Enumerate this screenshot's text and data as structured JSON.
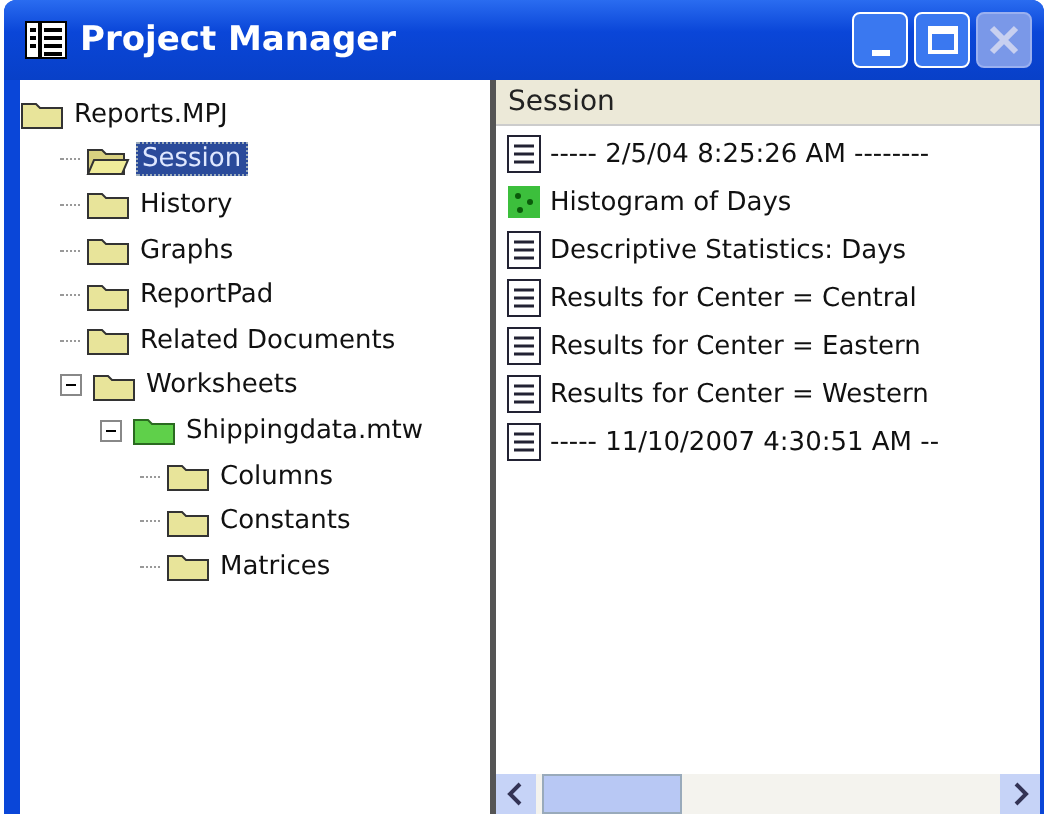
{
  "window": {
    "title": "Project Manager"
  },
  "tree": [
    {
      "label": "Reports.MPJ",
      "kind": "folder",
      "selected": false,
      "children": [
        {
          "label": "Session",
          "kind": "open-folder",
          "selected": true
        },
        {
          "label": "History",
          "kind": "folder",
          "selected": false
        },
        {
          "label": "Graphs",
          "kind": "folder",
          "selected": false
        },
        {
          "label": "ReportPad",
          "kind": "folder",
          "selected": false
        },
        {
          "label": "Related Documents",
          "kind": "folder",
          "selected": false
        },
        {
          "label": "Worksheets",
          "kind": "folder",
          "selected": false,
          "expanded": true,
          "children": [
            {
              "label": "Shippingdata.mtw",
              "kind": "worksheet",
              "selected": false,
              "expanded": true,
              "children": [
                {
                  "label": "Columns",
                  "kind": "folder",
                  "selected": false
                },
                {
                  "label": "Constants",
                  "kind": "folder",
                  "selected": false
                },
                {
                  "label": "Matrices",
                  "kind": "folder",
                  "selected": false
                }
              ]
            }
          ]
        }
      ]
    }
  ],
  "session": {
    "header": "Session",
    "items": [
      {
        "kind": "text",
        "label": "-----   2/5/04 8:25:26 AM   --------"
      },
      {
        "kind": "graph",
        "label": "Histogram of Days"
      },
      {
        "kind": "text",
        "label": "Descriptive Statistics: Days"
      },
      {
        "kind": "text",
        "label": "Results for Center = Central"
      },
      {
        "kind": "text",
        "label": "Results for Center = Eastern"
      },
      {
        "kind": "text",
        "label": "Results for Center = Western"
      },
      {
        "kind": "text",
        "label": "-----   11/10/2007 4:30:51 AM   --"
      }
    ]
  }
}
